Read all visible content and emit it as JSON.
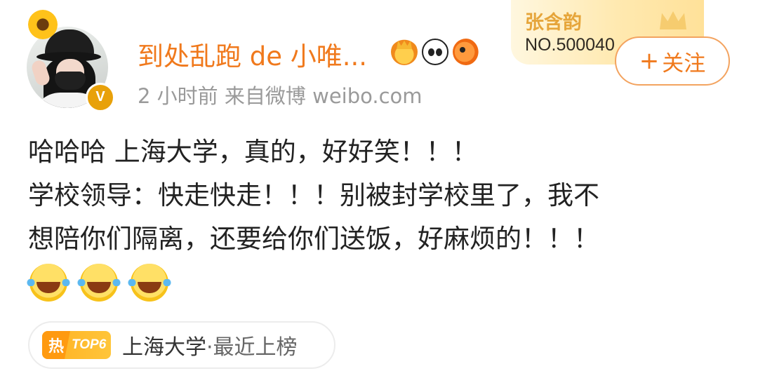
{
  "user": {
    "name": "到处乱跑 de 小唯...",
    "meta": "2 小时前  来自微博 weibo.com",
    "verified_badge": "V"
  },
  "card": {
    "name": "张含韵",
    "number": "NO.500040"
  },
  "follow_button": {
    "icon": "+",
    "label": "关注"
  },
  "post": {
    "lines": [
      "哈哈哈 上海大学，真的，好好笑！！！",
      "学校领导：快走快走！！！别被封学校里了，我不",
      "想陪你们隔离，还要给你们送饭，好麻烦的！！！"
    ],
    "emojis": [
      "laugh-cry-emoji",
      "laugh-cry-emoji",
      "laugh-cry-emoji"
    ]
  },
  "topic": {
    "hot_icon": "热",
    "rank": "TOP6",
    "title": "上海大学",
    "suffix": "·最近上榜"
  },
  "colors": {
    "username": "#f0791c",
    "meta": "#9a9a9a",
    "text": "#222222",
    "hot": "#ff9a10"
  }
}
